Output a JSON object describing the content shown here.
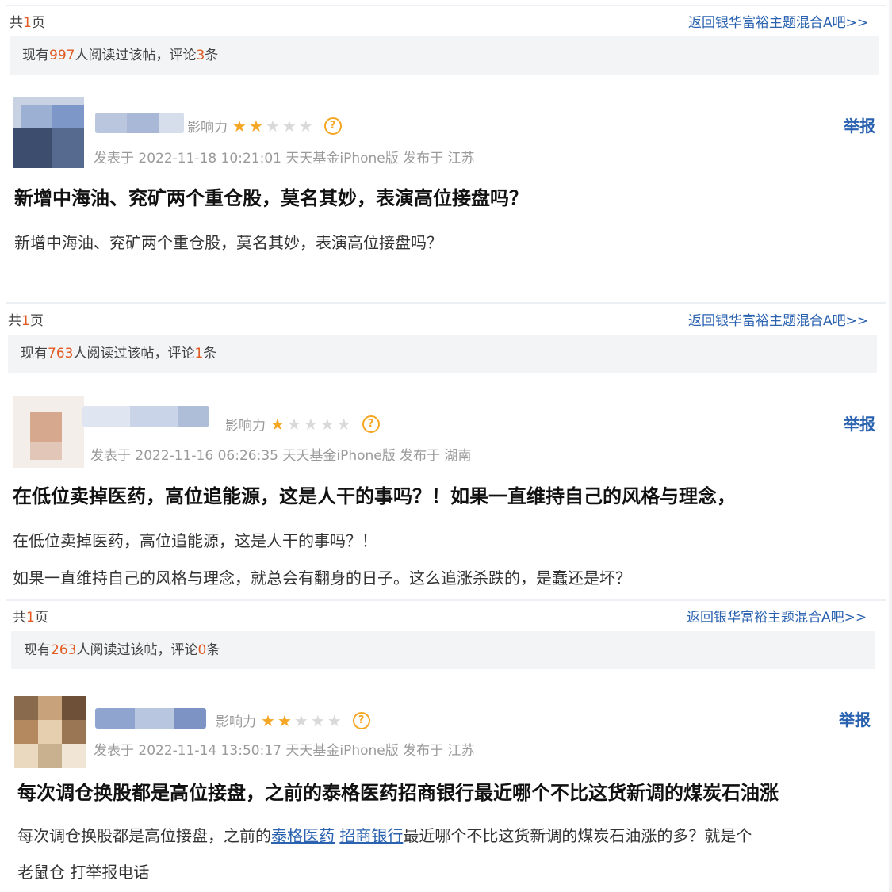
{
  "posts": [
    {
      "pages_prefix": "共",
      "pages_num": "1",
      "pages_suffix": "页",
      "back_link": "返回银华富裕主题混合A吧>>",
      "stats_prefix": "现有",
      "reads": "997",
      "stats_mid": "人阅读过该帖，评论",
      "comments": "3",
      "stats_suffix": "条",
      "influence_label": "影响力",
      "stars_on": 2,
      "stars_total": 5,
      "meta": "发表于 2022-11-18 10:21:01 天天基金iPhone版 发布于 江苏",
      "report": "举报",
      "title": "新增中海油、兖矿两个重仓股，莫名其妙，表演高位接盘吗？",
      "body_lines": [
        "新增中海油、兖矿两个重仓股，莫名其妙，表演高位接盘吗？"
      ]
    },
    {
      "pages_prefix": "共",
      "pages_num": "1",
      "pages_suffix": "页",
      "back_link": "返回银华富裕主题混合A吧>>",
      "stats_prefix": "现有",
      "reads": "763",
      "stats_mid": "人阅读过该帖，评论",
      "comments": "1",
      "stats_suffix": "条",
      "influence_label": "影响力",
      "stars_on": 1,
      "stars_total": 5,
      "meta": "发表于 2022-11-16 06:26:35 天天基金iPhone版 发布于 湖南",
      "report": "举报",
      "title": "在低位卖掉医药，高位追能源，这是人干的事吗？！如果一直维持自己的风格与理念，",
      "body_lines": [
        "在低位卖掉医药，高位追能源，这是人干的事吗？！",
        "如果一直维持自己的风格与理念，就总会有翻身的日子。这么追涨杀跌的，是蠢还是坏？"
      ]
    },
    {
      "pages_prefix": "共",
      "pages_num": "1",
      "pages_suffix": "页",
      "back_link": "返回银华富裕主题混合A吧>>",
      "stats_prefix": "现有",
      "reads": "263",
      "stats_mid": "人阅读过该帖，评论",
      "comments": "0",
      "stats_suffix": "条",
      "influence_label": "影响力",
      "stars_on": 2,
      "stars_total": 5,
      "meta": "发表于 2022-11-14 13:50:17 天天基金iPhone版 发布于 江苏",
      "report": "举报",
      "title": "每次调仓换股都是高位接盘，之前的泰格医药招商银行最近哪个不比这货新调的煤炭石油涨",
      "body_line1_a": "每次调仓换股都是高位接盘，之前的",
      "body_link1": "泰格医药",
      "body_link2": "招商银行",
      "body_line1_b": "最近哪个不比这货新调的煤炭石油涨的多？就是个",
      "body_line2": "老鼠仓 打举报电话"
    }
  ],
  "colors": {
    "accent_orange": "#e15b22",
    "link_blue": "#2a62b0",
    "star": "#f5a623"
  },
  "icons": {
    "star": "star-icon",
    "help": "question-mark-icon"
  }
}
